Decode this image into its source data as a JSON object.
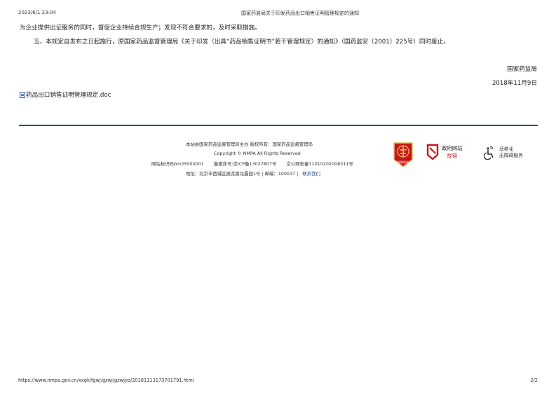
{
  "print_header": {
    "datetime": "2023/6/1 23:04",
    "title": "国家药监局关于印发药品出口销售证明管理规定的通知"
  },
  "body": {
    "paragraph_1": "为企业提供出证服务的同时，督促企业持续合规生产；发现不符合要求的，及时采取措施。",
    "paragraph_2": "五、本规定自发布之日起施行，原国家药品监督管理局《关于印发〈出具“药品销售证明书”若干管理规定〉的通知》（国药监安〔2001〕225号）同时废止。",
    "signature_org": "国家药监局",
    "signature_date": "2018年11月9日",
    "attachment": "药品出口销售证明管理规定.doc"
  },
  "footer": {
    "line_1": "本站由国家药品监督管理局主办 版权所有：国家药品监督管理局",
    "line_2": "Copyright © NMPA All Rights Reserved",
    "icp_site": "网站标识码bm35000001",
    "icp_record": "备案序号:京ICP备13027807号",
    "police_record": "京公网安备11010202008311号",
    "address": "地址：北京市西城区展览路北露园1号 | 邮编：100037 |",
    "contact_link": "联系我们",
    "seal_label": "党政机关",
    "gov_find_label": "政府网站",
    "gov_find_sub": "找错",
    "access_label_1": "适老化",
    "access_label_2": "无障碍服务"
  },
  "print_footer": {
    "url": "https://www.nmpa.gov.cn/xxgk/fgwj/gzwj/gzwjyp/20181113173701791.html",
    "page": "2/2"
  },
  "colors": {
    "rule_blue": "#2a4c8f",
    "seal_red": "#c8161d",
    "seal_gold": "#e8c46a"
  }
}
